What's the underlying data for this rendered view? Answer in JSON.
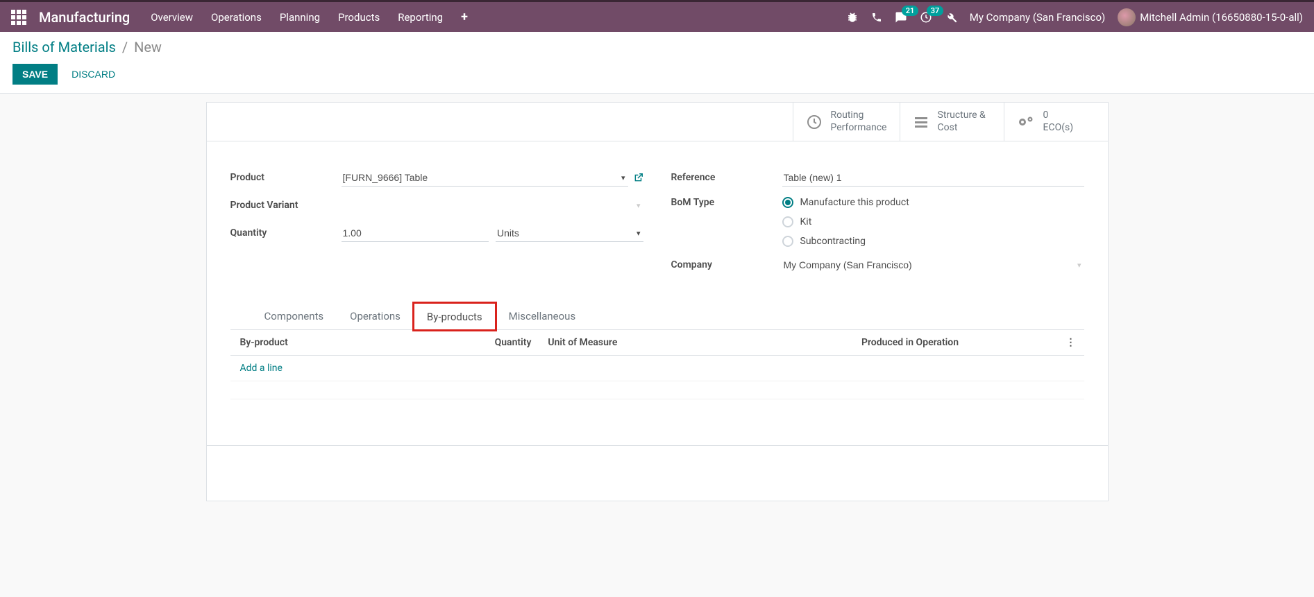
{
  "nav": {
    "brand": "Manufacturing",
    "menu": [
      "Overview",
      "Operations",
      "Planning",
      "Products",
      "Reporting"
    ],
    "badge_msg": "21",
    "badge_act": "37",
    "company": "My Company (San Francisco)",
    "user": "Mitchell Admin (16650880-15-0-all)"
  },
  "breadcrumb": {
    "root": "Bills of Materials",
    "current": "New"
  },
  "buttons": {
    "save": "SAVE",
    "discard": "DISCARD"
  },
  "stats": {
    "routing_l1": "Routing",
    "routing_l2": "Performance",
    "struct_l1": "Structure &",
    "struct_l2": "Cost",
    "eco_count": "0",
    "eco_label": "ECO(s)"
  },
  "form": {
    "product_label": "Product",
    "product_value": "[FURN_9666] Table",
    "variant_label": "Product Variant",
    "variant_value": "",
    "quantity_label": "Quantity",
    "quantity_value": "1.00",
    "uom_value": "Units",
    "reference_label": "Reference",
    "reference_value": "Table (new) 1",
    "bom_type_label": "BoM Type",
    "bom_options": {
      "manufacture": "Manufacture this product",
      "kit": "Kit",
      "sub": "Subcontracting"
    },
    "company_label": "Company",
    "company_value": "My Company (San Francisco)"
  },
  "tabs": {
    "components": "Components",
    "operations": "Operations",
    "byproducts": "By-products",
    "misc": "Miscellaneous"
  },
  "table": {
    "col_byproduct": "By-product",
    "col_quantity": "Quantity",
    "col_uom": "Unit of Measure",
    "col_produced": "Produced in Operation",
    "add_line": "Add a line"
  }
}
